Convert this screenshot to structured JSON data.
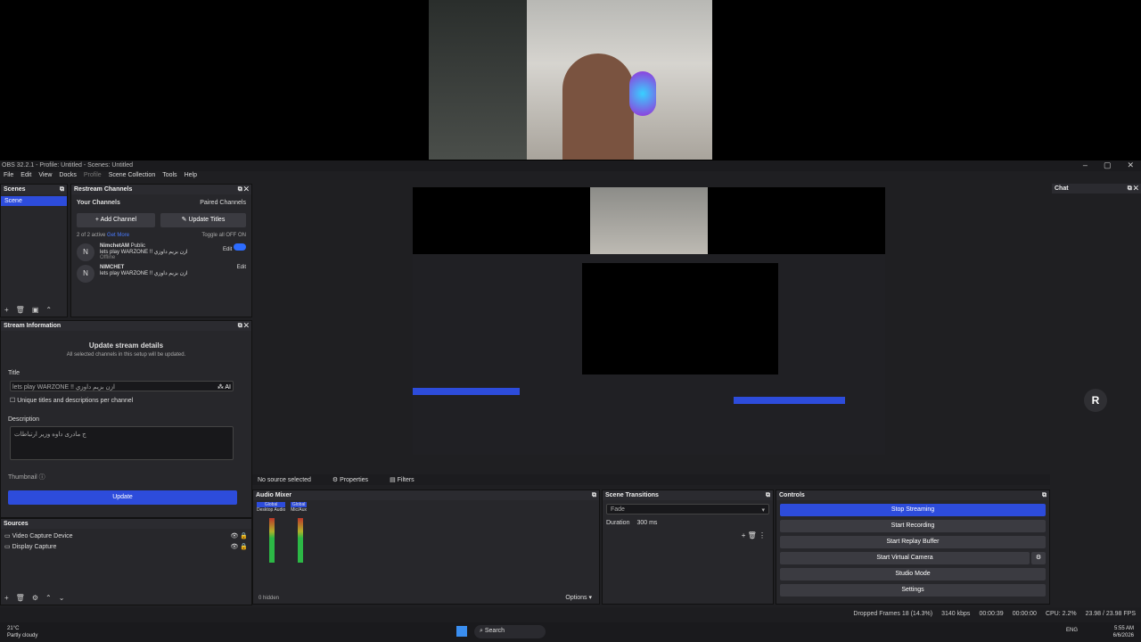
{
  "window": {
    "title": "OBS 32.2.1 - Profile: Untitled - Scenes: Untitled",
    "min": "–",
    "max": "▢",
    "close": "✕"
  },
  "menu": [
    "File",
    "Edit",
    "View",
    "Docks",
    "Profile",
    "Scene Collection",
    "Tools",
    "Help"
  ],
  "scenes": {
    "title": "Scenes",
    "items": [
      "Scene"
    ]
  },
  "restream": {
    "title": "Restream Channels",
    "your_channels": "Your Channels",
    "paired": "Paired Channels",
    "add_channel": "Add Channel",
    "update_titles": "Update Titles",
    "active": "2 of 2 active",
    "get_more": "Get More",
    "toggle_off": "Toggle all OFF",
    "on": "ON",
    "channels": [
      {
        "name": "NimchetAM",
        "badge": "Public",
        "edit": "Edit",
        "title": "lets play WARZONE !! ازن بزيم داوزي",
        "status": "Offline"
      },
      {
        "name": "NIMCHET",
        "edit": "Edit",
        "title": "lets play WARZONE !! ازن بزيم داوزي"
      }
    ]
  },
  "stream_info": {
    "title": "Stream Information",
    "heading": "Update stream details",
    "sub": "All selected channels in this setup will be updated.",
    "title_label": "Title",
    "title_value": "lets play WARZONE !! ازن بزيم داوزي",
    "ai": "AI",
    "unique": "Unique titles and descriptions per channel",
    "desc_label": "Description",
    "desc_value": "ج مادرى داوه وزير ارتباطات",
    "thumb": "Thumbnail",
    "update": "Update"
  },
  "sources": {
    "title": "Sources",
    "items": [
      "Video Capture Device",
      "Display Capture"
    ]
  },
  "strip": {
    "no_source": "No source selected",
    "properties": "Properties",
    "filters": "Filters"
  },
  "mixer": {
    "title": "Audio Mixer",
    "ch1": "Desktop Audio",
    "ch2": "Mic/Aux",
    "global": "Global",
    "hidden": "0 hidden"
  },
  "transitions": {
    "title": "Scene Transitions",
    "type": "Fade",
    "duration_label": "Duration",
    "duration": "300 ms"
  },
  "controls": {
    "title": "Controls",
    "buttons": [
      "Stop Streaming",
      "Start Recording",
      "Start Replay Buffer",
      "Start Virtual Camera",
      "Studio Mode",
      "Settings"
    ]
  },
  "chat": {
    "title": "Chat",
    "logo": "R"
  },
  "status": {
    "dropped": "Dropped Frames 18 (14.3%)",
    "kbps": "3140 kbps",
    "time1": "00:00:39",
    "time2": "00:00:00",
    "cpu": "CPU: 2.2%",
    "fps": "23.98 / 23.98 FPS"
  },
  "options": "Options",
  "taskbar": {
    "weather_temp": "21°C",
    "weather": "Partly cloudy",
    "search": "Search",
    "lang": "ENG",
    "time": "5:55 AM",
    "date": "6/6/2026"
  }
}
